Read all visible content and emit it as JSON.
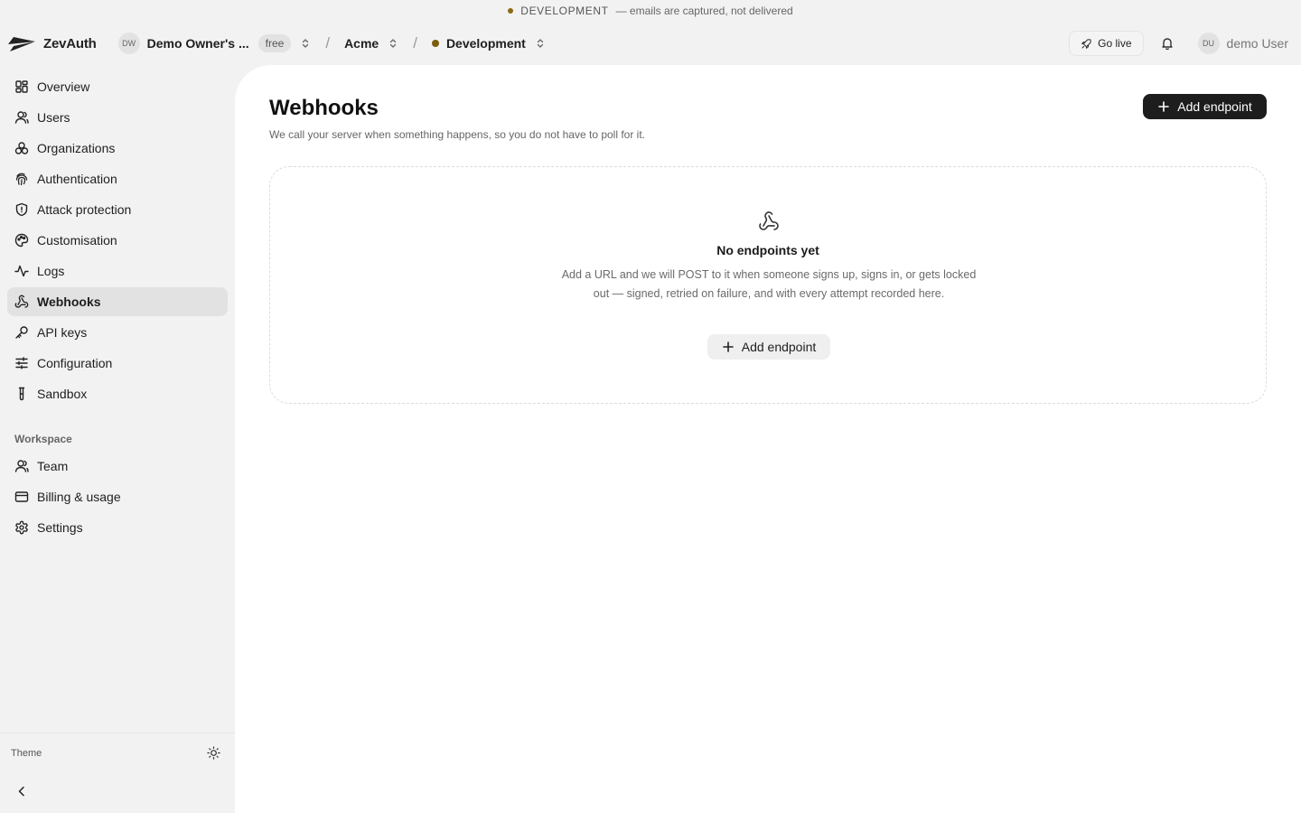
{
  "banner": {
    "env_label": "DEVELOPMENT",
    "message": "— emails are captured, not delivered"
  },
  "header": {
    "app_name": "ZevAuth",
    "owner_initials": "DW",
    "owner_name": "Demo Owner's ...",
    "plan_badge": "free",
    "org_name": "Acme",
    "environment": "Development",
    "go_live_label": "Go live",
    "user_initials": "DU",
    "user_name": "demo User"
  },
  "sidebar": {
    "items": [
      {
        "label": "Overview",
        "icon": "grid-icon"
      },
      {
        "label": "Users",
        "icon": "user-icon"
      },
      {
        "label": "Organizations",
        "icon": "organizations-icon"
      },
      {
        "label": "Authentication",
        "icon": "fingerprint-icon"
      },
      {
        "label": "Attack protection",
        "icon": "shield-icon"
      },
      {
        "label": "Customisation",
        "icon": "palette-icon"
      },
      {
        "label": "Logs",
        "icon": "activity-icon"
      },
      {
        "label": "Webhooks",
        "icon": "webhook-icon",
        "active": true
      },
      {
        "label": "API keys",
        "icon": "key-icon"
      },
      {
        "label": "Configuration",
        "icon": "sliders-icon"
      },
      {
        "label": "Sandbox",
        "icon": "test-tube-icon"
      }
    ],
    "workspace_title": "Workspace",
    "workspace_items": [
      {
        "label": "Team",
        "icon": "user-icon"
      },
      {
        "label": "Billing & usage",
        "icon": "credit-card-icon"
      },
      {
        "label": "Settings",
        "icon": "gear-icon"
      }
    ],
    "theme_label": "Theme"
  },
  "main": {
    "title": "Webhooks",
    "subtitle": "We call your server when something happens, so you do not have to poll for it.",
    "add_button_label": "Add endpoint",
    "empty": {
      "title": "No endpoints yet",
      "description": "Add a URL and we will POST to it when someone signs up, signs in, or gets locked out — signed, retried on failure, and with every attempt recorded here.",
      "button_label": "Add endpoint"
    }
  },
  "colors": {
    "accent_dark": "#1d1d1d",
    "env_dot": "#7a5c0a",
    "sidebar_bg": "#f2f2f2",
    "active_item_bg": "#e2e2e2"
  }
}
